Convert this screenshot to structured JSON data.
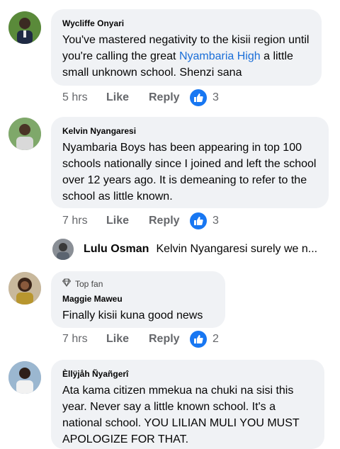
{
  "comments": [
    {
      "author": "Wycliffe Onyari",
      "text_before": "You've mastered negativity to the kisii region until you're calling the great ",
      "link": "Nyambaria High",
      "text_after": " a little small unknown school. Shenzi sana",
      "time": "5 hrs",
      "like": "Like",
      "reply": "Reply",
      "reactions": "3"
    },
    {
      "author": "Kelvin Nyangaresi",
      "text": "Nyambaria Boys has been appearing in top 100 schools nationally since I joined and left the school over 12 years ago. It is demeaning to refer to the school as little known.",
      "time": "7 hrs",
      "like": "Like",
      "reply": "Reply",
      "reactions": "3"
    },
    {
      "badge": "Top fan",
      "author": "Maggie Maweu",
      "text": "Finally kisii kuna good news",
      "time": "7 hrs",
      "like": "Like",
      "reply": "Reply",
      "reactions": "2"
    },
    {
      "author": "Èllÿjåh Ñyañgerî",
      "text": "Ata kama  citizen mmekua na chuki na sisi this year. Never say a little known school. It's a national school. YOU LILIAN MULI YOU MUST APOLOGIZE FOR THAT."
    }
  ],
  "reply_preview": {
    "author": "Lulu Osman",
    "text": "Kelvin Nyangaresi surely we n..."
  },
  "colors": {
    "bubble": "#f0f2f5",
    "accent": "#1877f2",
    "link": "#1a6ed8",
    "meta": "#65676b"
  }
}
